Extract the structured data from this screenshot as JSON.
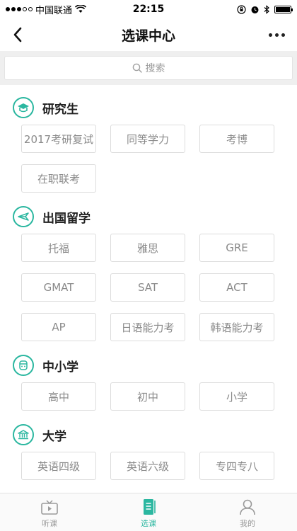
{
  "status_bar": {
    "carrier": "中国联通",
    "time": "22:15"
  },
  "nav": {
    "title": "选课中心",
    "back_icon": "chevron-left-icon",
    "more_icon": "more-dots-icon"
  },
  "search": {
    "placeholder": "搜索",
    "icon": "search-icon"
  },
  "sections": [
    {
      "title": "研究生",
      "icon": "graduation-cap-icon",
      "tags": [
        "2017考研复试",
        "同等学力",
        "考博",
        "在职联考"
      ]
    },
    {
      "title": "出国留学",
      "icon": "airplane-icon",
      "tags": [
        "托福",
        "雅思",
        "GRE",
        "GMAT",
        "SAT",
        "ACT",
        "AP",
        "日语能力考",
        "韩语能力考"
      ]
    },
    {
      "title": "中小学",
      "icon": "student-icon",
      "tags": [
        "高中",
        "初中",
        "小学"
      ]
    },
    {
      "title": "大学",
      "icon": "university-icon",
      "tags": [
        "英语四级",
        "英语六级",
        "专四专八"
      ]
    }
  ],
  "tabbar": {
    "items": [
      {
        "label": "听课",
        "icon": "tv-icon",
        "active": false
      },
      {
        "label": "选课",
        "icon": "course-book-icon",
        "active": true
      },
      {
        "label": "我的",
        "icon": "profile-icon",
        "active": false
      }
    ],
    "accent": "#2bb7a0"
  },
  "colors": {
    "accent": "#2bb7a0",
    "tag_border": "#dcdcdc",
    "tag_text": "#8a8a8a",
    "search_bg": "#efefef"
  }
}
